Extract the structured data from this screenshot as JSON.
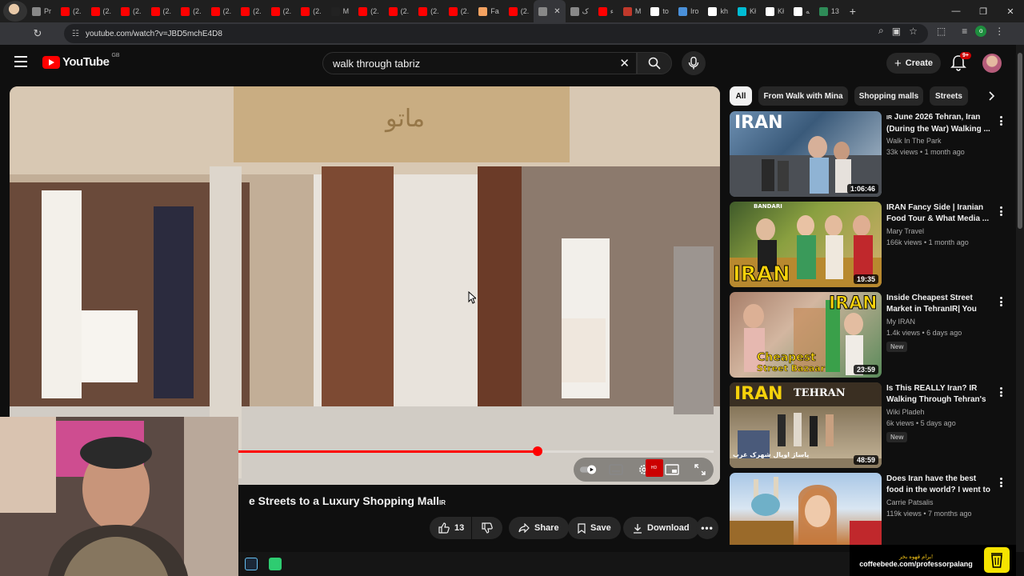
{
  "browser": {
    "tabs": [
      {
        "label": "Pr",
        "color": "#888888"
      },
      {
        "label": "(2.",
        "color": "#ff0000"
      },
      {
        "label": "(2.",
        "color": "#ff0000"
      },
      {
        "label": "(2.",
        "color": "#ff0000"
      },
      {
        "label": "(2.",
        "color": "#ff0000"
      },
      {
        "label": "(2.",
        "color": "#ff0000"
      },
      {
        "label": "(2.",
        "color": "#ff0000"
      },
      {
        "label": "(2.",
        "color": "#ff0000"
      },
      {
        "label": "(2.",
        "color": "#ff0000"
      },
      {
        "label": "(2.",
        "color": "#ff0000"
      },
      {
        "label": "M",
        "color": "#222222"
      },
      {
        "label": "(2.",
        "color": "#ff0000"
      },
      {
        "label": "(2.",
        "color": "#ff0000"
      },
      {
        "label": "(2.",
        "color": "#ff0000"
      },
      {
        "label": "(2.",
        "color": "#ff0000"
      },
      {
        "label": "Fa",
        "color": "#f4a261"
      },
      {
        "label": "(2.",
        "color": "#ff0000"
      }
    ],
    "active_tab_label": "",
    "tabs_after": [
      {
        "label": "ک",
        "color": "#888888"
      },
      {
        "label": "ء",
        "color": "#ff0000"
      },
      {
        "label": "M",
        "color": "#c0392b"
      },
      {
        "label": "to",
        "color": "#ffffff"
      },
      {
        "label": "Iro",
        "color": "#4a90d9"
      },
      {
        "label": "kh",
        "color": "#ffffff"
      },
      {
        "label": "Kł",
        "color": "#00bcd4"
      },
      {
        "label": "Kł",
        "color": "#ffffff"
      },
      {
        "label": "ﻪ",
        "color": "#ffffff"
      },
      {
        "label": "13",
        "color": "#2e8b57"
      }
    ],
    "url": "youtube.com/watch?v=JBD5mchE4D8",
    "extension_letter": "o"
  },
  "masthead": {
    "logo_text": "YouTube",
    "country_code": "GB",
    "search_query": "walk through tabriz",
    "create_label": "Create",
    "notification_count": "9+"
  },
  "player": {
    "progress_fraction": 0.75,
    "hd_label": "HD"
  },
  "video": {
    "title": "e Streets to a Luxury Shopping Mall",
    "title_flag": "IR",
    "likes": "13",
    "share_label": "Share",
    "save_label": "Save",
    "download_label": "Download"
  },
  "chips": [
    {
      "label": "All",
      "active": true
    },
    {
      "label": "From Walk with Mina",
      "active": false
    },
    {
      "label": "Shopping malls",
      "active": false
    },
    {
      "label": "Streets",
      "active": false
    }
  ],
  "recommendations": [
    {
      "title": "🇮🇷 June 2026 Tehran, Iran (During the War) Walking ...",
      "title_flag": "IR",
      "title_text": "June 2026 Tehran, Iran (During the War) Walking ...",
      "channel": "Walk In The Park",
      "meta": "33k views • 1 month ago",
      "duration": "1:06:46",
      "badge": "",
      "overlay": "IRAN"
    },
    {
      "title_flag": "",
      "title_text": "IRAN Fancy Side | Iranian Food Tour & What Media ...",
      "channel": "Mary Travel",
      "meta": "166k views • 1 month ago",
      "duration": "19:35",
      "badge": "",
      "overlay": "IRAN",
      "overlay2": "BANDARI"
    },
    {
      "title_flag": "",
      "title_text": "Inside Cheapest Street Market in TehranIR| You Ca...",
      "channel": "My IRAN",
      "meta": "1.4k views • 6 days ago",
      "duration": "23:59",
      "badge": "New",
      "overlay": "IRAN",
      "overlay2": "Cheapest",
      "overlay3": "Street Bazaar"
    },
    {
      "title_flag": "",
      "title_text": "Is This REALLY Iran? IR Walking Through Tehran's ...",
      "channel": "Wiki Pladeh",
      "meta": "6k views • 5 days ago",
      "duration": "48:59",
      "badge": "New",
      "overlay": "IRAN",
      "overlay2": "TEHRAN",
      "overlay3": "پاساژ اوپال شهرک غرب"
    },
    {
      "title_flag": "",
      "title_text": "Does Iran have the best food in the world? I went to Qo...",
      "channel": "Carrie Patsalis",
      "meta": "119k views • 7 months ago",
      "duration": "",
      "badge": "",
      "overlay": ""
    }
  ],
  "coffee_banner": {
    "line1": "برام قهوه بخر!",
    "line2": "coffeebede.com/professorpalang"
  }
}
